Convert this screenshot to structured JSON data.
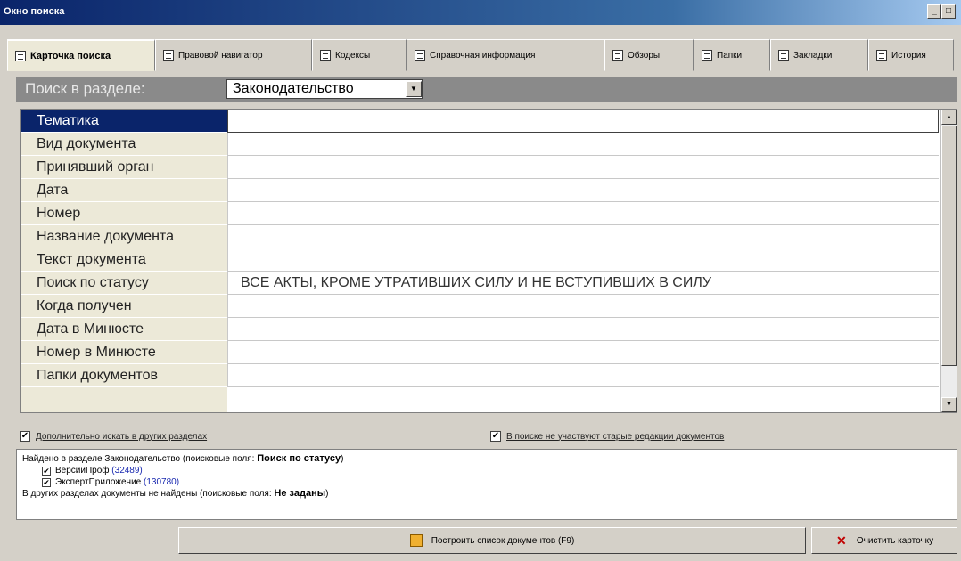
{
  "window": {
    "title": "Окно поиска",
    "buttons": [
      "_",
      "□"
    ]
  },
  "tabs": [
    {
      "label": "Карточка поиска",
      "active": true
    },
    {
      "label": "Правовой навигатор"
    },
    {
      "label": "Кодексы"
    },
    {
      "label": "Справочная информация"
    },
    {
      "label": "Обзоры"
    },
    {
      "label": "Папки"
    },
    {
      "label": "Закладки"
    },
    {
      "label": "История"
    }
  ],
  "search": {
    "section_label": "Поиск в разделе:",
    "section_value": "Законодательство"
  },
  "fields": [
    {
      "label": "Тематика",
      "value": ""
    },
    {
      "label": "Вид документа",
      "value": ""
    },
    {
      "label": "Принявший орган",
      "value": ""
    },
    {
      "label": "Дата",
      "value": ""
    },
    {
      "label": "Номер",
      "value": ""
    },
    {
      "label": "Название документа",
      "value": ""
    },
    {
      "label": "Текст документа",
      "value": ""
    },
    {
      "label": "Поиск по статусу",
      "value": "ВСЕ АКТЫ, КРОМЕ УТРАТИВШИХ СИЛУ И НЕ ВСТУПИВШИХ В СИЛУ"
    },
    {
      "label": "Когда получен",
      "value": ""
    },
    {
      "label": "Дата в Минюсте",
      "value": ""
    },
    {
      "label": "Номер в Минюсте",
      "value": ""
    },
    {
      "label": "Папки документов",
      "value": ""
    }
  ],
  "options": {
    "extra_sections": "Дополнительно искать в других разделах",
    "old_editions": "В поиске не участвуют старые редакции документов"
  },
  "results": {
    "line1_prefix": "Найдено в разделе Законодательство (поисковые поля:",
    "line1_bold": "Поиск по статусу",
    "line1_suffix": ")",
    "sub1_name": "ВерсииПроф",
    "sub1_count": "(32489)",
    "sub2_name": "ЭкспертПриложение",
    "sub2_count": "(130780)",
    "line2_prefix": "В других разделах документы не найдены (поисковые поля:",
    "line2_bold": "Не заданы",
    "line2_suffix": ")"
  },
  "buttons": {
    "build": "Построить список документов (F9)",
    "clear": "Очистить карточку"
  }
}
